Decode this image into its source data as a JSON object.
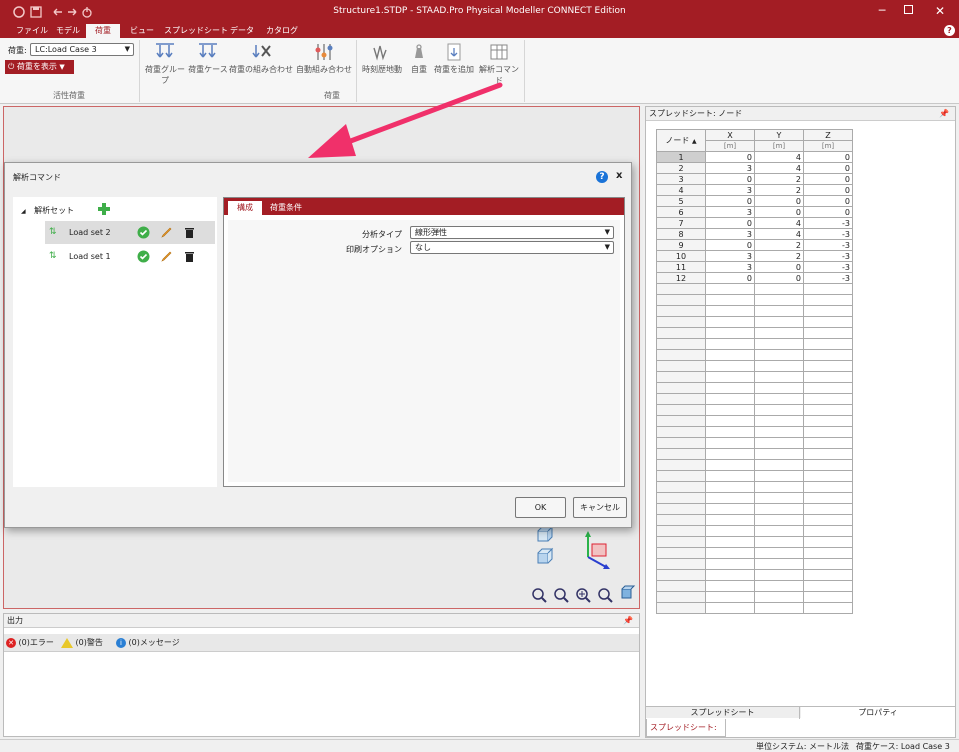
{
  "window": {
    "title": "Structure1.STDP - STAAD.Pro Physical Modeller CONNECT Edition"
  },
  "ribbon_tabs": [
    "ファイル",
    "モデル",
    "荷重",
    "ビュー",
    "スプレッドシート",
    "データ",
    "カタログ"
  ],
  "ribbon": {
    "load_label": "荷重:",
    "load_combo_value": "LC:Load Case 3",
    "show_load_label": "荷重を表示",
    "group_active_load": "活性荷重",
    "group_load": "荷重",
    "buttons": [
      "荷重グループ",
      "荷重ケース",
      "荷重の組み合わせ",
      "自動組み合わせ",
      "時刻歴地動",
      "自重",
      "荷重を追加",
      "解析コマンド"
    ]
  },
  "dialog": {
    "title": "解析コマンド",
    "close_label": "x",
    "help_label": "?",
    "tree_root": "解析セット",
    "tree_items": [
      {
        "label": "Load set 2"
      },
      {
        "label": "Load set 1"
      }
    ],
    "tabs": [
      "構成",
      "荷重条件"
    ],
    "analysis_type_label": "分析タイプ",
    "analysis_type_value": "線形弾性",
    "print_option_label": "印刷オプション",
    "print_option_value": "なし",
    "ok_label": "OK",
    "cancel_label": "キャンセル"
  },
  "output": {
    "title": "出力",
    "tabs": [
      {
        "label": "(0)エラー",
        "icon": "error-icon"
      },
      {
        "label": "(0)警告",
        "icon": "warning-icon"
      },
      {
        "label": "(0)メッセージ",
        "icon": "info-icon"
      }
    ]
  },
  "spreadsheet": {
    "title": "スプレッドシート: ノード",
    "headers": [
      "ノード",
      "X",
      "Y",
      "Z"
    ],
    "units": [
      "",
      "[m]",
      "[m]",
      "[m]"
    ],
    "rows": [
      [
        "1",
        "0",
        "4",
        "0"
      ],
      [
        "2",
        "3",
        "4",
        "0"
      ],
      [
        "3",
        "0",
        "2",
        "0"
      ],
      [
        "4",
        "3",
        "2",
        "0"
      ],
      [
        "5",
        "0",
        "0",
        "0"
      ],
      [
        "6",
        "3",
        "0",
        "0"
      ],
      [
        "7",
        "0",
        "4",
        "-3"
      ],
      [
        "8",
        "3",
        "4",
        "-3"
      ],
      [
        "9",
        "0",
        "2",
        "-3"
      ],
      [
        "10",
        "3",
        "2",
        "-3"
      ],
      [
        "11",
        "3",
        "0",
        "-3"
      ],
      [
        "12",
        "0",
        "0",
        "-3"
      ]
    ],
    "bottom_tabs": [
      "スプレッドシート",
      "プロパティ"
    ],
    "footer_tab": "スプレッドシート: ノード"
  },
  "statusbar": {
    "units": "単位システム:  メートル法",
    "load_case": "荷重ケース:  Load Case 3"
  },
  "colors": {
    "brand": "#a31d24",
    "arrow": "#f0306a",
    "check": "#3fae49"
  }
}
